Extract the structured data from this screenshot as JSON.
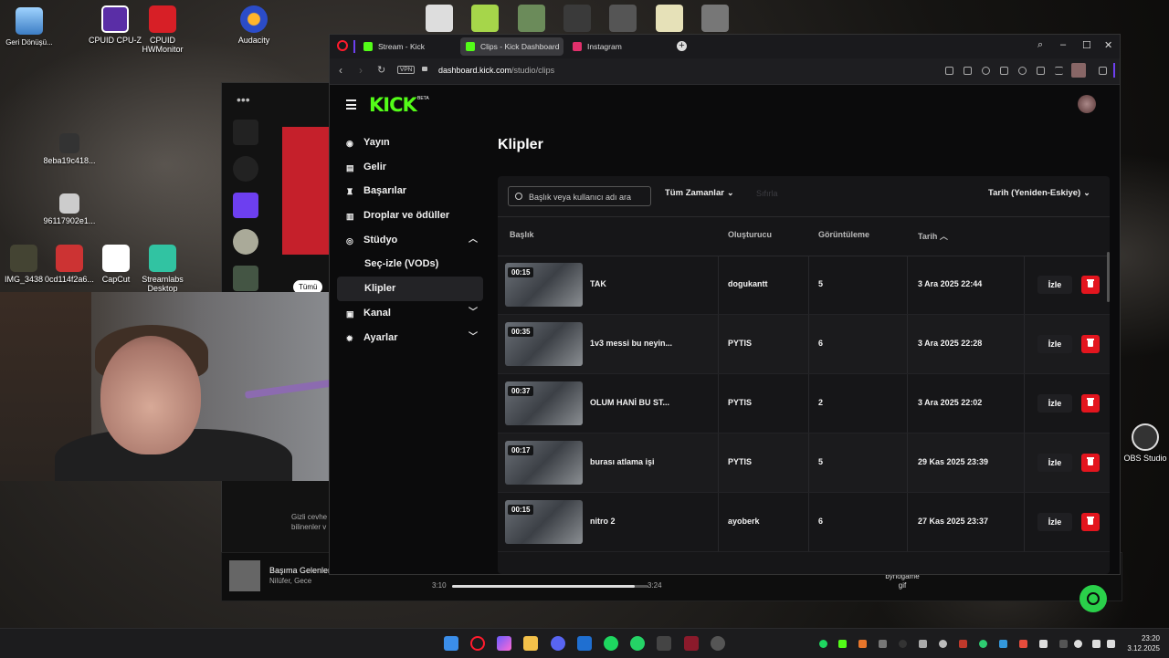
{
  "desktop": {
    "icons": [
      {
        "label": "Geri Dönüşü...",
        "name": "recycle-bin-icon",
        "x": 0
      },
      {
        "label": "CPUID CPU-Z",
        "name": "cpuz-icon"
      },
      {
        "label": "CPUID HWMonitor",
        "name": "hwmonitor-icon"
      },
      {
        "label": "Audacity",
        "name": "audacity-icon"
      },
      {
        "label": "8eba19c418...",
        "name": "file-icon-1"
      },
      {
        "label": "96117902e1...",
        "name": "file-icon-2"
      },
      {
        "label": "IMG_3438",
        "name": "file-icon-3"
      },
      {
        "label": "0cd114f2a6...",
        "name": "file-icon-4"
      },
      {
        "label": "CapCut",
        "name": "capcut-icon"
      },
      {
        "label": "Streamlabs Desktop",
        "name": "streamlabs-icon"
      },
      {
        "label": "OBS Studio",
        "name": "obs-icon"
      },
      {
        "label": "bynogame gif",
        "name": "gif-file-icon"
      }
    ]
  },
  "spotify": {
    "chip": "Tümü",
    "promo": "Gizli cevhe bilinenler v",
    "track_title": "Başıma Gelenler",
    "track_artist": "Nilüfer, Gece",
    "time_elapsed": "3:10",
    "time_total": "3:24",
    "progress": 0.93
  },
  "browser": {
    "tabs": [
      {
        "label": "Stream - Kick Dashboard",
        "color": "#53fc18"
      },
      {
        "label": "Clips - Kick Dashboard",
        "color": "#53fc18",
        "active": true
      },
      {
        "label": "Instagram",
        "color": "#e1306c"
      }
    ],
    "vpn": "VPN",
    "url_domain": "dashboard.kick.com",
    "url_path": "/studio/clips"
  },
  "kick": {
    "logo": "KICK",
    "beta": "BETA",
    "accent": "#53fc18",
    "sidebar": [
      {
        "label": "Yayın",
        "icon": "broadcast-icon"
      },
      {
        "label": "Gelir",
        "icon": "revenue-icon"
      },
      {
        "label": "Başarılar",
        "icon": "trophy-icon"
      },
      {
        "label": "Droplar ve ödüller",
        "icon": "drops-icon"
      },
      {
        "label": "Stüdyo",
        "icon": "studio-icon"
      },
      {
        "label": "Seç-izle (VODs)"
      },
      {
        "label": "Klipler"
      },
      {
        "label": "Kanal",
        "icon": "channel-icon"
      },
      {
        "label": "Ayarlar",
        "icon": "settings-icon"
      }
    ],
    "page_title": "Klipler",
    "search_placeholder": "Başlık veya kullanıcı adı ara",
    "time_filter": "Tüm Zamanlar",
    "clear_label": "Sıfırla",
    "sort": "Tarih (Yeniden-Eskiye)",
    "columns": {
      "title": "Başlık",
      "creator": "Oluşturucu",
      "views": "Görüntüleme",
      "date": "Tarih"
    },
    "watch_label": "İzle",
    "clips": [
      {
        "duration": "00:15",
        "title": "TAK",
        "creator": "dogukantt",
        "views": "5",
        "date": "3 Ara 2025 22:44"
      },
      {
        "duration": "00:35",
        "title": "1v3 messi bu neyin...",
        "creator": "PYTIS",
        "views": "6",
        "date": "3 Ara 2025 22:28"
      },
      {
        "duration": "00:37",
        "title": "OLUM HANİ BU ST...",
        "creator": "PYTIS",
        "views": "2",
        "date": "3 Ara 2025 22:02"
      },
      {
        "duration": "00:17",
        "title": "burası atlama işi",
        "creator": "PYTIS",
        "views": "5",
        "date": "29 Kas 2025 23:39"
      },
      {
        "duration": "00:15",
        "title": "nitro 2",
        "creator": "ayoberk",
        "views": "6",
        "date": "27 Kas 2025 23:37"
      }
    ]
  },
  "taskbar": {
    "time": "23:20",
    "date": "3.12.2025"
  }
}
